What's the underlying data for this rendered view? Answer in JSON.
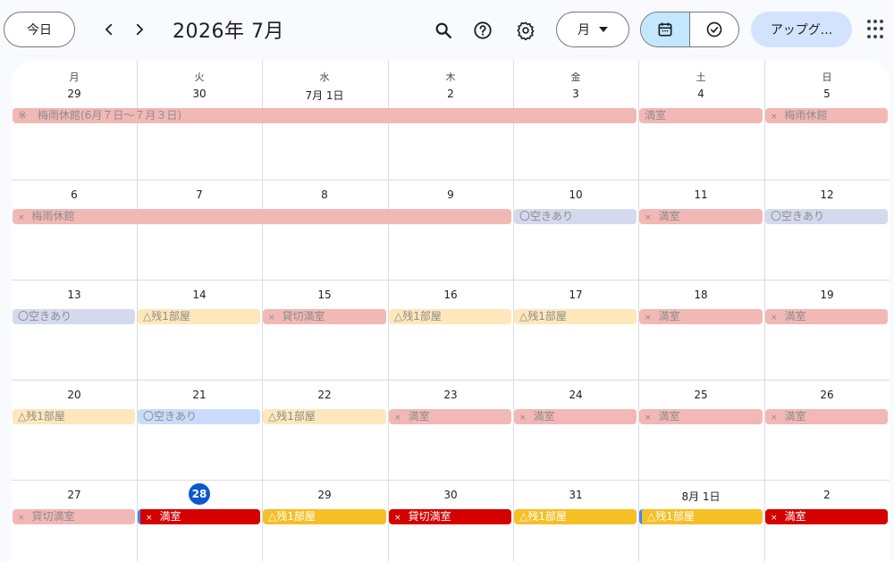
{
  "header": {
    "today_label": "今日",
    "title": "2026年 7月",
    "view_label": "月",
    "upgrade_label": "アップグ..."
  },
  "icons": {
    "prev": "chevron-left-icon",
    "next": "chevron-right-icon",
    "search": "search-icon",
    "help": "help-icon",
    "settings": "gear-icon",
    "calendar": "calendar-icon",
    "tasks": "task-check-icon",
    "apps": "apps-grid-icon"
  },
  "colors": {
    "full": "#f2b8b5",
    "available": "#d4d9ed",
    "few": "#fde7bb",
    "today": "#0b57d0",
    "full_strong": "#d50000",
    "few_strong": "#f6bf26"
  },
  "weekdays": [
    "月",
    "火",
    "水",
    "木",
    "金",
    "土",
    "日"
  ],
  "weeks": [
    {
      "days": [
        "29",
        "30",
        "7月 1日",
        "2",
        "3",
        "4",
        "5"
      ],
      "events": [
        {
          "label": "※　梅雨休館(6月７日～７月３日)",
          "col": 0,
          "span": 5,
          "style": "pink",
          "mark": ""
        },
        {
          "label": "満室",
          "col": 5,
          "span": 1,
          "style": "pink",
          "mark": ""
        },
        {
          "label": "梅雨休館",
          "col": 6,
          "span": 1,
          "style": "pink",
          "mark": "×"
        }
      ]
    },
    {
      "days": [
        "6",
        "7",
        "8",
        "9",
        "10",
        "11",
        "12"
      ],
      "events": [
        {
          "label": "梅雨休館",
          "col": 0,
          "span": 4,
          "style": "pink",
          "mark": "×"
        },
        {
          "label": "〇空きあり",
          "col": 4,
          "span": 1,
          "style": "lav",
          "mark": ""
        },
        {
          "label": "満室",
          "col": 5,
          "span": 1,
          "style": "pink",
          "mark": "×"
        },
        {
          "label": "〇空きあり",
          "col": 6,
          "span": 1,
          "style": "lav",
          "mark": ""
        }
      ]
    },
    {
      "days": [
        "13",
        "14",
        "15",
        "16",
        "17",
        "18",
        "19"
      ],
      "events": [
        {
          "label": "〇空きあり",
          "col": 0,
          "span": 1,
          "style": "lav",
          "mark": ""
        },
        {
          "label": "△残1部屋",
          "col": 1,
          "span": 1,
          "style": "yel",
          "mark": ""
        },
        {
          "label": "貸切満室",
          "col": 2,
          "span": 1,
          "style": "pink",
          "mark": "×"
        },
        {
          "label": "△残1部屋",
          "col": 3,
          "span": 1,
          "style": "yel",
          "mark": ""
        },
        {
          "label": "△残1部屋",
          "col": 4,
          "span": 1,
          "style": "yel",
          "mark": ""
        },
        {
          "label": "満室",
          "col": 5,
          "span": 1,
          "style": "pink",
          "mark": "×"
        },
        {
          "label": "満室",
          "col": 6,
          "span": 1,
          "style": "pink",
          "mark": "×"
        }
      ]
    },
    {
      "days": [
        "20",
        "21",
        "22",
        "23",
        "24",
        "25",
        "26"
      ],
      "events": [
        {
          "label": "△残1部屋",
          "col": 0,
          "span": 1,
          "style": "yel",
          "mark": ""
        },
        {
          "label": "〇空きあり",
          "col": 1,
          "span": 1,
          "style": "blu",
          "mark": ""
        },
        {
          "label": "△残1部屋",
          "col": 2,
          "span": 1,
          "style": "yel",
          "mark": ""
        },
        {
          "label": "満室",
          "col": 3,
          "span": 1,
          "style": "pink",
          "mark": "×"
        },
        {
          "label": "満室",
          "col": 4,
          "span": 1,
          "style": "pink",
          "mark": "×"
        },
        {
          "label": "満室",
          "col": 5,
          "span": 1,
          "style": "pink",
          "mark": "×"
        },
        {
          "label": "満室",
          "col": 6,
          "span": 1,
          "style": "pink",
          "mark": "×"
        }
      ]
    },
    {
      "days": [
        "27",
        "28",
        "29",
        "30",
        "31",
        "8月 1日",
        "2"
      ],
      "today_index": 1,
      "events": [
        {
          "label": "貸切満室",
          "col": 0,
          "span": 1,
          "style": "pink",
          "mark": "×"
        },
        {
          "label": "満室",
          "col": 1,
          "span": 1,
          "style": "red",
          "mark": "×",
          "bar": true
        },
        {
          "label": "△残1部屋",
          "col": 2,
          "span": 1,
          "style": "gold",
          "mark": ""
        },
        {
          "label": "貸切満室",
          "col": 3,
          "span": 1,
          "style": "red",
          "mark": "×"
        },
        {
          "label": "△残1部屋",
          "col": 4,
          "span": 1,
          "style": "gold",
          "mark": ""
        },
        {
          "label": "△残1部屋",
          "col": 5,
          "span": 1,
          "style": "gold",
          "mark": "",
          "bar": true
        },
        {
          "label": "満室",
          "col": 6,
          "span": 1,
          "style": "red",
          "mark": "×"
        }
      ]
    }
  ]
}
